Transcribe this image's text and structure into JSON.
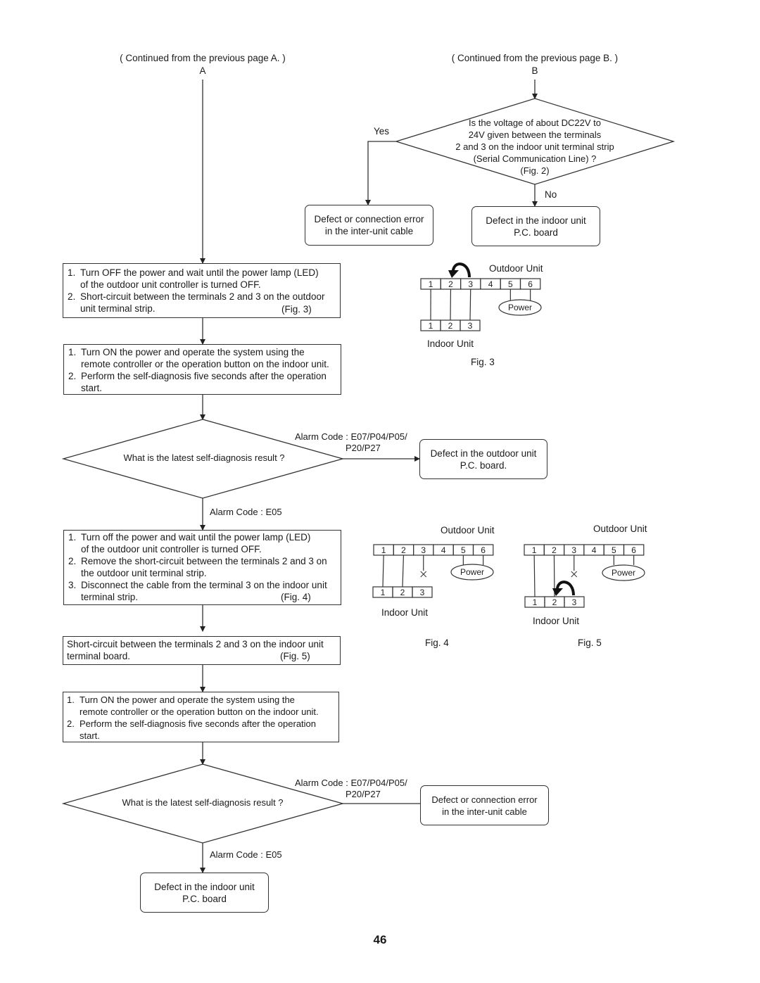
{
  "header": {
    "continued_a": "( Continued from the previous page A. )",
    "label_a": "A",
    "continued_b": "( Continued from the previous page B. )",
    "label_b": "B"
  },
  "decision_voltage": {
    "lines": [
      "Is the voltage of about DC22V to",
      "24V given between the terminals",
      "2 and 3 on the indoor unit terminal strip",
      "(Serial Communication Line) ?",
      "(Fig. 2)"
    ],
    "yes_label": "Yes",
    "no_label": "No"
  },
  "result_cable_top": {
    "lines": [
      "Defect or connection error",
      "in the inter-unit cable"
    ]
  },
  "result_indoor_top": {
    "lines": [
      "Defect in the indoor unit",
      "P.C. board"
    ]
  },
  "step1": {
    "items": [
      {
        "num": "1.",
        "text": "Turn OFF the power and wait until the power lamp (LED)\nof the outdoor unit controller is turned OFF."
      },
      {
        "num": "2.",
        "text": "Short-circuit between the terminals 2 and 3 on the outdoor\nunit terminal strip."
      }
    ],
    "figref": "(Fig. 3)"
  },
  "step2": {
    "items": [
      {
        "num": "1.",
        "text": "Turn ON the power and operate the system using the\nremote controller or the operation button on the indoor unit."
      },
      {
        "num": "2.",
        "text": "Perform the self-diagnosis five seconds after the operation\nstart."
      }
    ]
  },
  "decision_diag1": {
    "question": "What is the latest self-diagnosis result ?",
    "alarm_right_1": "Alarm Code : E07/P04/P05/",
    "alarm_right_2": "P20/P27",
    "alarm_down": "Alarm Code : E05"
  },
  "result_outdoor": {
    "lines": [
      "Defect in the outdoor unit",
      "P.C. board."
    ]
  },
  "step3": {
    "items": [
      {
        "num": "1.",
        "text": "Turn off the power and wait until the power lamp (LED)\nof the outdoor unit controller is turned OFF."
      },
      {
        "num": "2.",
        "text": "Remove the short-circuit between the terminals 2 and 3 on\nthe outdoor unit terminal strip."
      },
      {
        "num": "3.",
        "text": "Disconnect the cable from the terminal 3 on the indoor unit\nterminal strip."
      }
    ],
    "figref": "(Fig. 4)"
  },
  "step4": {
    "text": "Short-circuit between the terminals 2 and 3 on the indoor unit\nterminal board.",
    "figref": "(Fig. 5)"
  },
  "step5": {
    "items": [
      {
        "num": "1.",
        "text": "Turn ON the power and operate the system using the\nremote controller or the operation button on the indoor unit."
      },
      {
        "num": "2.",
        "text": "Perform the self-diagnosis five seconds after the operation\nstart."
      }
    ]
  },
  "decision_diag2": {
    "question": "What is the latest self-diagnosis result ?",
    "alarm_right_1": "Alarm Code : E07/P04/P05/",
    "alarm_right_2": "P20/P27",
    "alarm_down": "Alarm Code : E05"
  },
  "result_cable_bottom": {
    "lines": [
      "Defect or connection error",
      "in the inter-unit cable"
    ]
  },
  "result_indoor_bottom": {
    "lines": [
      "Defect in the indoor unit",
      "P.C. board"
    ]
  },
  "figures": {
    "outdoor_label": "Outdoor Unit",
    "indoor_label": "Indoor Unit",
    "power_label": "Power",
    "outdoor_terminals": [
      "1",
      "2",
      "3",
      "4",
      "5",
      "6"
    ],
    "indoor_terminals": [
      "1",
      "2",
      "3"
    ],
    "fig3": "Fig. 3",
    "fig4": "Fig. 4",
    "fig5": "Fig. 5"
  },
  "page_number": "46"
}
